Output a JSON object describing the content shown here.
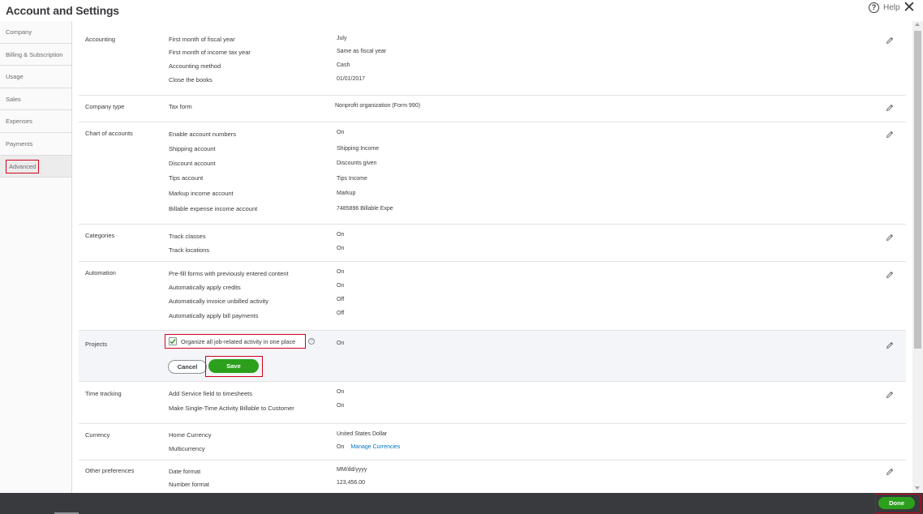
{
  "header": {
    "title": "Account and Settings",
    "help_label": "Help",
    "help_icon": "?",
    "close_icon": "✕"
  },
  "sidebar": {
    "items": [
      {
        "label": "Company"
      },
      {
        "label": "Billing & Subscription"
      },
      {
        "label": "Usage"
      },
      {
        "label": "Sales"
      },
      {
        "label": "Expenses"
      },
      {
        "label": "Payments"
      },
      {
        "label": "Advanced",
        "active": true
      }
    ]
  },
  "sections": {
    "accounting": {
      "title": "Accounting",
      "rows": [
        {
          "label": "First month of fiscal year",
          "value": "July"
        },
        {
          "label": "First month of income tax year",
          "value": "Same as fiscal year"
        },
        {
          "label": "Accounting method",
          "value": "Cash"
        },
        {
          "label": "Close the books",
          "value": "01/01/2017"
        }
      ]
    },
    "company_type": {
      "title": "Company type",
      "rows": [
        {
          "label": "Tax form",
          "value": "Nonprofit organization (Form 990)"
        }
      ]
    },
    "chart_of_accounts": {
      "title": "Chart of accounts",
      "rows": [
        {
          "label": "Enable account numbers",
          "value": "On"
        },
        {
          "label": "Shipping account",
          "value": "Shipping Income"
        },
        {
          "label": "Discount account",
          "value": "Discounts given"
        },
        {
          "label": "Tips account",
          "value": "Tips Income"
        },
        {
          "label": "Markup income account",
          "value": "Markup"
        },
        {
          "label": "Billable expense income account",
          "value": "7485896 Billable Expe"
        }
      ]
    },
    "categories": {
      "title": "Categories",
      "rows": [
        {
          "label": "Track classes",
          "value": "On"
        },
        {
          "label": "Track locations",
          "value": "On"
        }
      ]
    },
    "automation": {
      "title": "Automation",
      "rows": [
        {
          "label": "Pre-fill forms with previously entered content",
          "value": "On"
        },
        {
          "label": "Automatically apply credits",
          "value": "On"
        },
        {
          "label": "Automatically invoice unbilled activity",
          "value": "Off"
        },
        {
          "label": "Automatically apply bill payments",
          "value": "Off"
        }
      ]
    },
    "projects": {
      "title": "Projects",
      "checkbox_label": "Organize all job-related activity in one place",
      "checked": true,
      "info_icon": "?",
      "value": "On",
      "cancel_label": "Cancel",
      "save_label": "Save"
    },
    "time_tracking": {
      "title": "Time tracking",
      "rows": [
        {
          "label": "Add Service field to timesheets",
          "value": "On"
        },
        {
          "label": "Make Single-Time Activity Billable to Customer",
          "value": "On"
        }
      ]
    },
    "currency": {
      "title": "Currency",
      "rows": [
        {
          "label": "Home Currency",
          "value": "United States Dollar"
        },
        {
          "label": "Multicurrency",
          "value": "On"
        }
      ],
      "manage_link": "Manage Currencies"
    },
    "other_preferences": {
      "title": "Other preferences",
      "rows": [
        {
          "label": "Date format",
          "value": "MM/dd/yyyy"
        },
        {
          "label": "Number format",
          "value": "123,456.00"
        }
      ]
    }
  },
  "footer": {
    "done_label": "Done"
  },
  "colors": {
    "accent_green": "#2ca01c",
    "highlight_red": "#d0021b",
    "link_blue": "#0077c5",
    "footer_bg": "#393a3d"
  }
}
